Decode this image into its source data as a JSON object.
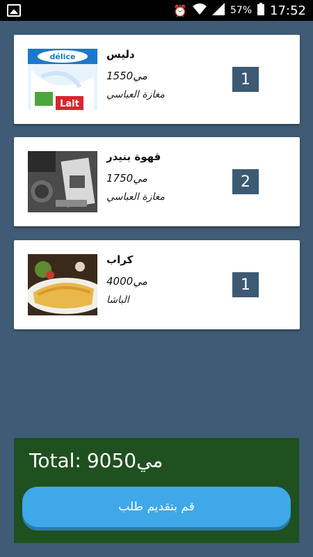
{
  "status_bar": {
    "battery_percent": "57%",
    "time": "17:52"
  },
  "cart": {
    "items": [
      {
        "name": "دليس",
        "price": "1550مي",
        "store": "مغازة العباسي",
        "quantity": "1",
        "image_text": "délice Lait"
      },
      {
        "name": "قهوة بنيدر",
        "price": "1750مي",
        "store": "مغازة العباسي",
        "quantity": "2"
      },
      {
        "name": "كراب",
        "price": "4000مي",
        "store": "الباشا",
        "quantity": "1"
      }
    ]
  },
  "footer": {
    "total_label": "Total:",
    "total_value": "9050مي",
    "submit_label": "قم بتقديم طلب"
  }
}
